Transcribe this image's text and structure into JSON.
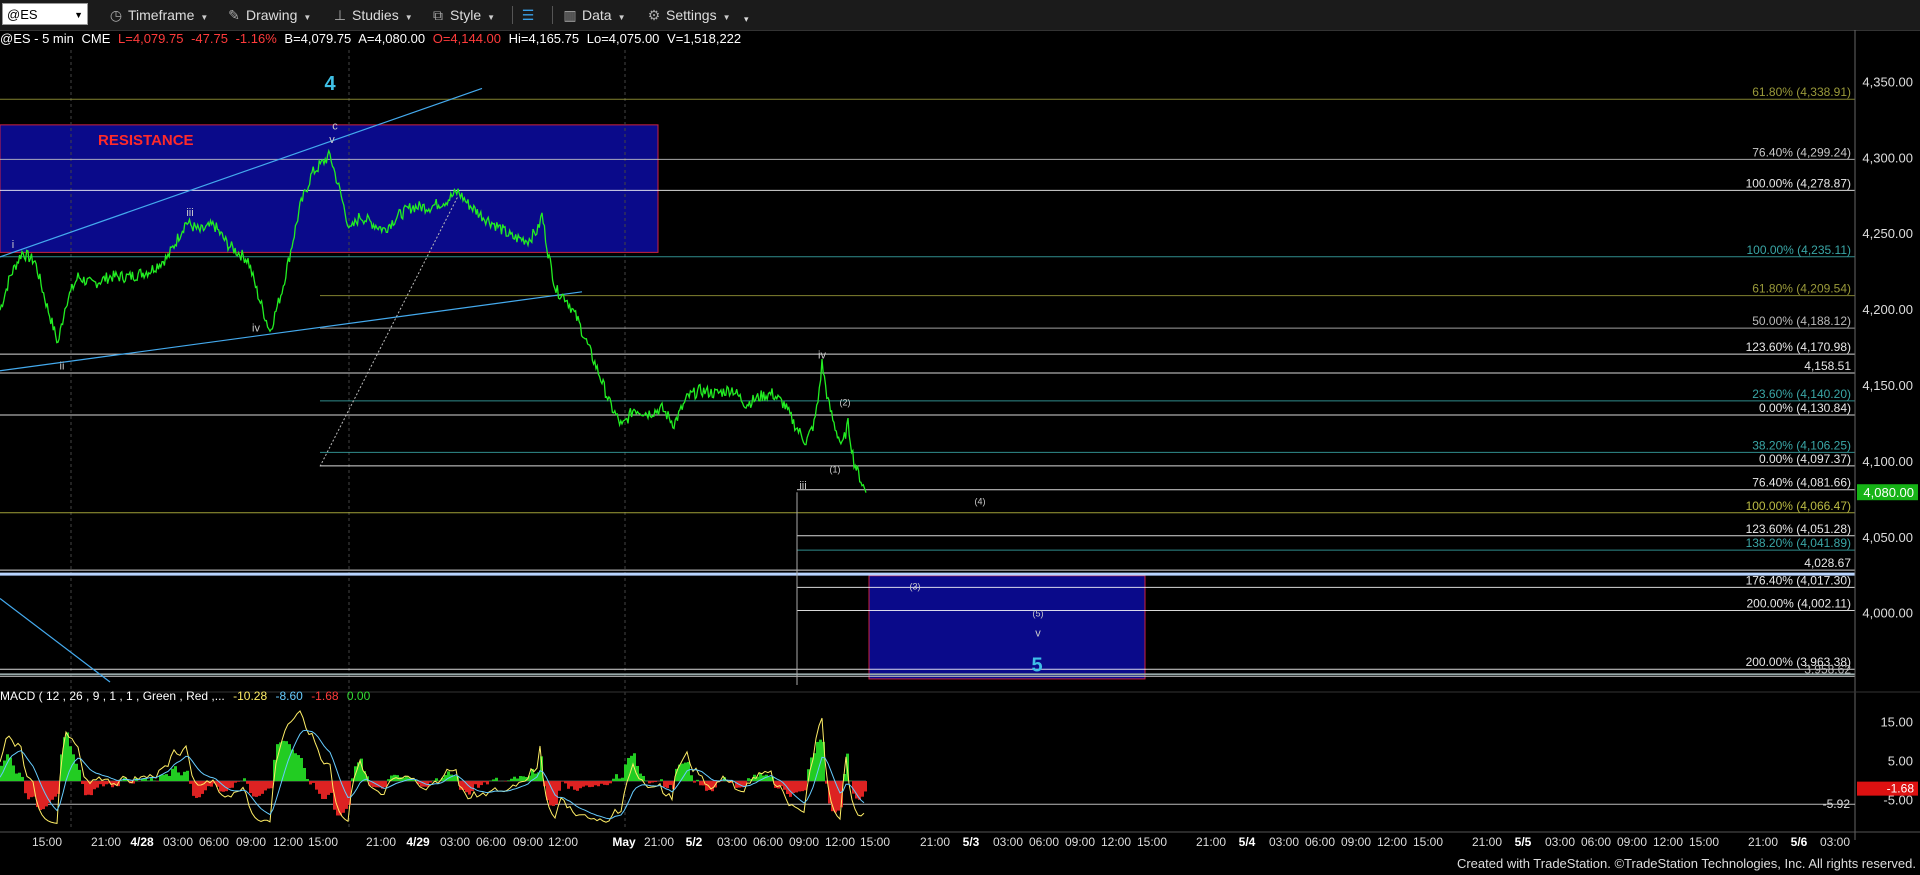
{
  "toolbar": {
    "symbol": "@ES",
    "items": [
      {
        "label": "Timeframe",
        "icon": "clock-icon"
      },
      {
        "label": "Drawing",
        "icon": "pencil-icon"
      },
      {
        "label": "Studies",
        "icon": "studies-icon"
      },
      {
        "label": "Style",
        "icon": "style-icon"
      },
      {
        "label": "Data",
        "icon": "data-icon"
      },
      {
        "label": "Settings",
        "icon": "gear-icon"
      }
    ]
  },
  "header": {
    "symbol_info": "@ES - 5 min",
    "exchange": "CME",
    "last": "L=4,079.75",
    "change": "-47.75",
    "change_pct": "-1.16%",
    "bid": "B=4,079.75",
    "ask": "A=4,080.00",
    "open": "O=4,144.00",
    "high": "Hi=4,165.75",
    "low": "Lo=4,075.00",
    "volume": "V=1,518,222"
  },
  "macd": {
    "label": "MACD ( 12 , 26 , 9 , 1 , 1 , Green , Red ,...",
    "v1": "-10.28",
    "v2": "-8.60",
    "v3": "-1.68",
    "v4": "0.00",
    "axis_ticks": [
      "15.00",
      "5.00",
      "-5.00"
    ],
    "line_value_label": "-5.92",
    "hist_value_label": "-1.68"
  },
  "footer": "Created with TradeStation. ©TradeStation Technologies, Inc. All rights reserved.",
  "chart_data": {
    "type": "line",
    "title": "@ES - 5 min",
    "ylim": [
      3953,
      4370
    ],
    "y_ticks": [
      "4,350.00",
      "4,300.00",
      "4,250.00",
      "4,200.00",
      "4,150.00",
      "4,100.00",
      "4,050.00",
      "4,000.00"
    ],
    "last_price_label": "4,080.00",
    "x_ticks": [
      {
        "t": 47,
        "label": "15:00"
      },
      {
        "t": 106,
        "label": "21:00"
      },
      {
        "t": 142,
        "label": "4/28"
      },
      {
        "t": 178,
        "label": "03:00"
      },
      {
        "t": 214,
        "label": "06:00"
      },
      {
        "t": 251,
        "label": "09:00"
      },
      {
        "t": 288,
        "label": "12:00"
      },
      {
        "t": 323,
        "label": "15:00"
      },
      {
        "t": 381,
        "label": "21:00"
      },
      {
        "t": 418,
        "label": "4/29"
      },
      {
        "t": 455,
        "label": "03:00"
      },
      {
        "t": 491,
        "label": "06:00"
      },
      {
        "t": 528,
        "label": "09:00"
      },
      {
        "t": 563,
        "label": "12:00"
      },
      {
        "t": 624,
        "label": "May"
      },
      {
        "t": 659,
        "label": "21:00"
      },
      {
        "t": 694,
        "label": "5/2"
      },
      {
        "t": 732,
        "label": "03:00"
      },
      {
        "t": 768,
        "label": "06:00"
      },
      {
        "t": 804,
        "label": "09:00"
      },
      {
        "t": 840,
        "label": "12:00"
      },
      {
        "t": 875,
        "label": "15:00"
      },
      {
        "t": 935,
        "label": "21:00"
      },
      {
        "t": 971,
        "label": "5/3"
      },
      {
        "t": 1008,
        "label": "03:00"
      },
      {
        "t": 1044,
        "label": "06:00"
      },
      {
        "t": 1080,
        "label": "09:00"
      },
      {
        "t": 1116,
        "label": "12:00"
      },
      {
        "t": 1152,
        "label": "15:00"
      },
      {
        "t": 1211,
        "label": "21:00"
      },
      {
        "t": 1247,
        "label": "5/4"
      },
      {
        "t": 1284,
        "label": "03:00"
      },
      {
        "t": 1320,
        "label": "06:00"
      },
      {
        "t": 1356,
        "label": "09:00"
      },
      {
        "t": 1392,
        "label": "12:00"
      },
      {
        "t": 1428,
        "label": "15:00"
      },
      {
        "t": 1487,
        "label": "21:00"
      },
      {
        "t": 1523,
        "label": "5/5"
      },
      {
        "t": 1560,
        "label": "03:00"
      },
      {
        "t": 1596,
        "label": "06:00"
      },
      {
        "t": 1632,
        "label": "09:00"
      },
      {
        "t": 1668,
        "label": "12:00"
      },
      {
        "t": 1704,
        "label": "15:00"
      },
      {
        "t": 1763,
        "label": "21:00"
      },
      {
        "t": 1799,
        "label": "5/6"
      },
      {
        "t": 1835,
        "label": "03:00"
      }
    ],
    "price_series": [
      [
        0,
        4200
      ],
      [
        10,
        4222
      ],
      [
        22,
        4238
      ],
      [
        35,
        4232
      ],
      [
        46,
        4205
      ],
      [
        58,
        4178
      ],
      [
        66,
        4205
      ],
      [
        78,
        4222
      ],
      [
        92,
        4217
      ],
      [
        110,
        4222
      ],
      [
        130,
        4222
      ],
      [
        150,
        4226
      ],
      [
        168,
        4235
      ],
      [
        186,
        4258
      ],
      [
        200,
        4252
      ],
      [
        214,
        4256
      ],
      [
        228,
        4243
      ],
      [
        248,
        4233
      ],
      [
        258,
        4210
      ],
      [
        270,
        4186
      ],
      [
        282,
        4213
      ],
      [
        292,
        4243
      ],
      [
        300,
        4268
      ],
      [
        312,
        4290
      ],
      [
        324,
        4298
      ],
      [
        330,
        4302
      ],
      [
        340,
        4278
      ],
      [
        350,
        4252
      ],
      [
        360,
        4262
      ],
      [
        370,
        4258
      ],
      [
        384,
        4253
      ],
      [
        398,
        4262
      ],
      [
        412,
        4268
      ],
      [
        430,
        4268
      ],
      [
        446,
        4272
      ],
      [
        458,
        4278
      ],
      [
        468,
        4270
      ],
      [
        482,
        4262
      ],
      [
        498,
        4255
      ],
      [
        512,
        4248
      ],
      [
        528,
        4246
      ],
      [
        538,
        4253
      ],
      [
        542,
        4263
      ],
      [
        548,
        4238
      ],
      [
        556,
        4213
      ],
      [
        566,
        4208
      ],
      [
        578,
        4193
      ],
      [
        590,
        4173
      ],
      [
        602,
        4153
      ],
      [
        610,
        4138
      ],
      [
        622,
        4123
      ],
      [
        634,
        4135
      ],
      [
        648,
        4132
      ],
      [
        662,
        4135
      ],
      [
        674,
        4125
      ],
      [
        688,
        4143
      ],
      [
        700,
        4147
      ],
      [
        716,
        4145
      ],
      [
        732,
        4148
      ],
      [
        746,
        4138
      ],
      [
        760,
        4143
      ],
      [
        772,
        4145
      ],
      [
        784,
        4138
      ],
      [
        796,
        4123
      ],
      [
        806,
        4113
      ],
      [
        814,
        4125
      ],
      [
        818,
        4140
      ],
      [
        822,
        4165
      ],
      [
        828,
        4140
      ],
      [
        834,
        4125
      ],
      [
        842,
        4110
      ],
      [
        848,
        4125
      ],
      [
        854,
        4100
      ],
      [
        862,
        4086
      ],
      [
        866,
        4079.75
      ]
    ],
    "fib_levels": [
      {
        "price": 4338.91,
        "label": "61.80% (4,338.91)",
        "color": "#9a9a3a",
        "start": 0
      },
      {
        "price": 4299.24,
        "label": "76.40% (4,299.24)",
        "color": "#c8c8c8",
        "start": 0
      },
      {
        "price": 4278.87,
        "label": "100.00% (4,278.87)",
        "color": "#ffffff",
        "start": 0
      },
      {
        "price": 4235.11,
        "label": "100.00% (4,235.11)",
        "color": "#3aa6a6",
        "start": 0
      },
      {
        "price": 4209.54,
        "label": "61.80% (4,209.54)",
        "color": "#9a9a3a",
        "start": 320
      },
      {
        "price": 4188.12,
        "label": "50.00% (4,188.12)",
        "color": "#bbbbbb",
        "start": 320
      },
      {
        "price": 4170.98,
        "label": "123.60% (4,170.98)",
        "color": "#ffffff",
        "start": 0
      },
      {
        "price": 4158.51,
        "label": "4,158.51",
        "color": "#ffffff",
        "start": 0
      },
      {
        "price": 4140.2,
        "label": "23.60% (4,140.20)",
        "color": "#3aa6a6",
        "start": 320
      },
      {
        "price": 4130.84,
        "label": "0.00% (4,130.84)",
        "color": "#ffffff",
        "start": 0
      },
      {
        "price": 4106.25,
        "label": "38.20% (4,106.25)",
        "color": "#3aa6a6",
        "start": 320
      },
      {
        "price": 4097.37,
        "label": "0.00% (4,097.37)",
        "color": "#ffffff",
        "start": 320
      },
      {
        "price": 4081.66,
        "label": "76.40% (4,081.66)",
        "color": "#ffffff",
        "start": 797
      },
      {
        "price": 4066.47,
        "label": "100.00% (4,066.47)",
        "color": "#bbbb44",
        "start": 0
      },
      {
        "price": 4051.28,
        "label": "123.60% (4,051.28)",
        "color": "#ffffff",
        "start": 797
      },
      {
        "price": 4041.89,
        "label": "138.20% (4,041.89)",
        "color": "#3aa6a6",
        "start": 797
      },
      {
        "price": 4028.67,
        "label": "4,028.67",
        "color": "#ffffff",
        "start": 0
      },
      {
        "price": 4017.3,
        "label": "176.40% (4,017.30)",
        "color": "#ffffff",
        "start": 797
      },
      {
        "price": 4002.11,
        "label": "200.00% (4,002.11)",
        "color": "#ffffff",
        "start": 797
      },
      {
        "price": 3963.38,
        "label": "200.00% (3,963.38)",
        "color": "#ffffff",
        "start": 0
      },
      {
        "price": 3958.62,
        "label": "3,958.62",
        "color": "#bbbbbb",
        "start": 0
      }
    ],
    "zones": [
      {
        "label": "RESISTANCE",
        "t0": 0,
        "t1": 658,
        "p_top": 4322,
        "p_bot": 4238,
        "fill": "#0a0a8a",
        "stroke": "#cc2244"
      },
      {
        "label": "",
        "t0": 869,
        "t1": 1145,
        "p_top": 4025,
        "p_bot": 3957,
        "fill": "#0a0a8a",
        "stroke": "#cc2244"
      }
    ],
    "wave_labels": [
      {
        "text": "4",
        "t": 330,
        "p": 4345,
        "size": 20,
        "color": "#3fc0e6",
        "bold": true
      },
      {
        "text": "c",
        "t": 335,
        "p": 4319,
        "size": 11,
        "color": "#cccccc"
      },
      {
        "text": "v",
        "t": 332,
        "p": 4310,
        "size": 11,
        "color": "#cccccc"
      },
      {
        "text": "i",
        "t": 13,
        "p": 4241,
        "size": 11,
        "color": "#cccccc"
      },
      {
        "text": "iii",
        "t": 190,
        "p": 4262,
        "size": 11,
        "color": "#cccccc"
      },
      {
        "text": "iv",
        "t": 256,
        "p": 4186,
        "size": 11,
        "color": "#cccccc"
      },
      {
        "text": "ii",
        "t": 62,
        "p": 4161,
        "size": 11,
        "color": "#cccccc"
      },
      {
        "text": "iv",
        "t": 822,
        "p": 4168,
        "size": 11,
        "color": "#cccccc"
      },
      {
        "text": "(2)",
        "t": 845,
        "p": 4137,
        "size": 9,
        "color": "#cccccc"
      },
      {
        "text": "(1)",
        "t": 835,
        "p": 4093,
        "size": 9,
        "color": "#cccccc"
      },
      {
        "text": "iii",
        "t": 803,
        "p": 4082,
        "size": 11,
        "color": "#cccccc"
      },
      {
        "text": "(4)",
        "t": 980,
        "p": 4072,
        "size": 9,
        "color": "#cccccc"
      },
      {
        "text": "(3)",
        "t": 915,
        "p": 4016,
        "size": 9,
        "color": "#cccccc"
      },
      {
        "text": "(5)",
        "t": 1038,
        "p": 3998,
        "size": 9,
        "color": "#cccccc"
      },
      {
        "text": "v",
        "t": 1038,
        "p": 3985,
        "size": 11,
        "color": "#cccccc"
      },
      {
        "text": "5",
        "t": 1037,
        "p": 3962,
        "size": 20,
        "color": "#3fc0e6",
        "bold": true
      }
    ],
    "macd_ylim": [
      -12,
      22
    ]
  }
}
